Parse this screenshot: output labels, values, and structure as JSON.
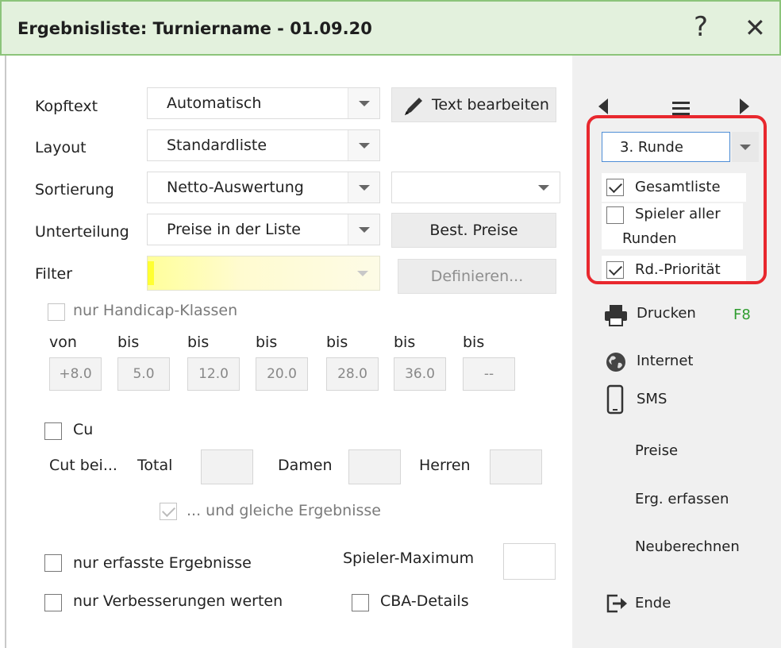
{
  "window": {
    "title": "Ergebnisliste: Turniername - 01.09.20",
    "help_label": "?",
    "close_label": "✕"
  },
  "form": {
    "kopftext": {
      "label": "Kopftext",
      "value": "Automatisch"
    },
    "layout": {
      "label": "Layout",
      "value": "Standardliste"
    },
    "sortierung": {
      "label": "Sortierung",
      "value": "Netto-Auswertung",
      "secondary_value": ""
    },
    "unterteilung": {
      "label": "Unterteilung",
      "value": "Preise in der Liste"
    },
    "filter": {
      "label": "Filter",
      "value": ""
    },
    "text_bearbeiten_label": "Text bearbeiten",
    "best_preise_label": "Best. Preise",
    "definieren_label": "Definieren..."
  },
  "handicap": {
    "checkbox_label": "nur Handicap-Klassen",
    "checked": false,
    "headers": [
      "von",
      "bis",
      "bis",
      "bis",
      "bis",
      "bis",
      "bis"
    ],
    "values": [
      "+8.0",
      "5.0",
      "12.0",
      "20.0",
      "28.0",
      "36.0",
      "--"
    ]
  },
  "cut": {
    "checkbox_label": "Cu",
    "checked": false,
    "cut_bei_label": "Cut bei...",
    "total_label": "Total",
    "damen_label": "Damen",
    "herren_label": "Herren",
    "gleiche_label": "... und gleiche Ergebnisse",
    "gleiche_checked": true
  },
  "options": {
    "nur_erfasste_label": "nur erfasste Ergebnisse",
    "nur_erfasste_checked": false,
    "spieler_maximum_label": "Spieler-Maximum",
    "spieler_maximum_value": "",
    "nur_verbesserungen_label": "nur Verbesserungen werten",
    "nur_verbesserungen_checked": false,
    "cba_details_label": "CBA-Details",
    "cba_details_checked": false
  },
  "sidebar": {
    "round_value": "3. Runde",
    "gesamtliste_label": "Gesamtliste",
    "gesamtliste_checked": true,
    "spieler_aller_label_1": "Spieler aller",
    "spieler_aller_label_2": "Runden",
    "spieler_aller_checked": false,
    "rd_prioritaet_label": "Rd.-Priorität",
    "rd_prioritaet_checked": true,
    "drucken_label": "Drucken",
    "drucken_shortcut": "F8",
    "internet_label": "Internet",
    "sms_label": "SMS",
    "preise_label": "Preise",
    "erg_erfassen_label": "Erg. erfassen",
    "neuberechnen_label": "Neuberechnen",
    "ende_label": "Ende",
    "highlight_color": "#e8282e"
  },
  "colors": {
    "titlebar_bg": "#e3f1dd",
    "titlebar_border": "#8cc47a",
    "shortcut_green": "#2e9c2e",
    "filter_highlight": "#ffff66"
  }
}
